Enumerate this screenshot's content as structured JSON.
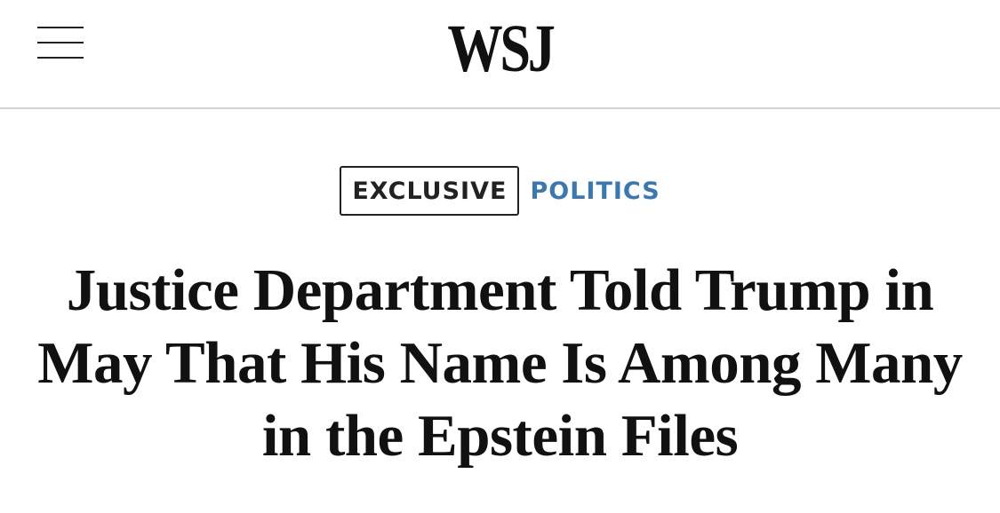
{
  "header": {
    "logo": "WSJ",
    "menu_icon": "hamburger-menu-icon"
  },
  "article": {
    "tag_exclusive": "EXCLUSIVE",
    "section": "POLITICS",
    "headline": "Justice Department Told Trump in May That His Name Is Among Many in the Epstein Files"
  },
  "colors": {
    "section_link": "#3a78b4",
    "text": "#111111",
    "divider": "#d4d4d4"
  }
}
